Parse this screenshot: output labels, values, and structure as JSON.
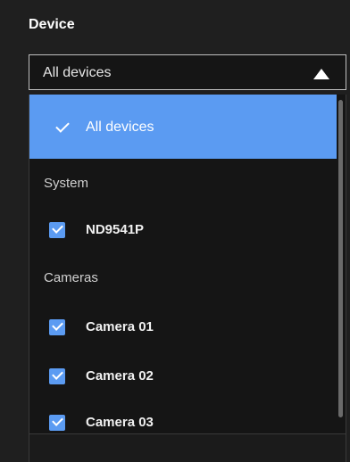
{
  "section": {
    "title": "Device"
  },
  "select": {
    "value": "All devices"
  },
  "dropdown": {
    "all_option": "All devices",
    "groups": [
      {
        "label": "System",
        "items": [
          {
            "label": "ND9541P",
            "checked": true
          }
        ]
      },
      {
        "label": "Cameras",
        "items": [
          {
            "label": "Camera 01",
            "checked": true
          },
          {
            "label": "Camera 02",
            "checked": true
          },
          {
            "label": "Camera 03",
            "checked": true
          }
        ]
      }
    ]
  },
  "colors": {
    "accent": "#5b9bf2",
    "panel_bg": "#1f1f1f",
    "list_bg": "#151515"
  },
  "icons": {
    "select_caret": "caret-up-icon",
    "selected": "checkmark-icon",
    "checkbox": "checkbox-checked-icon"
  }
}
